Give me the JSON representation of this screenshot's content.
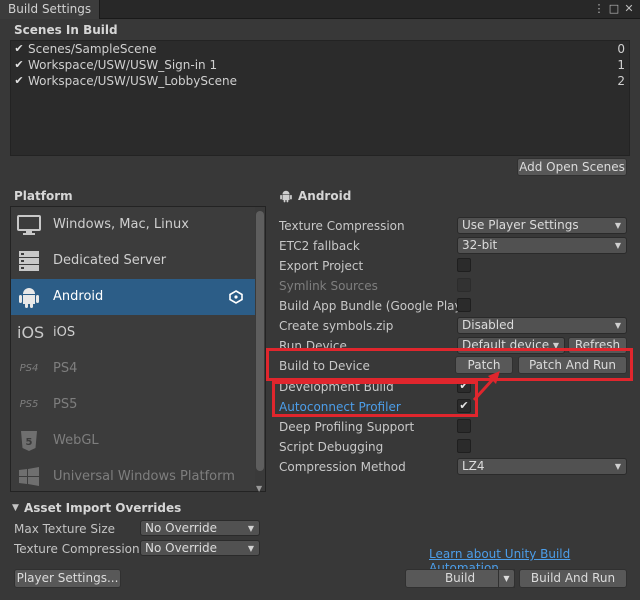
{
  "window": {
    "tab_title": "Build Settings"
  },
  "scenes": {
    "title": "Scenes In Build",
    "items": [
      {
        "name": "Scenes/SampleScene",
        "index": "0",
        "checked": true
      },
      {
        "name": "Workspace/USW/USW_Sign-in 1",
        "index": "1",
        "checked": true
      },
      {
        "name": "Workspace/USW/USW_LobbyScene",
        "index": "2",
        "checked": true
      }
    ],
    "add_open_scenes": "Add Open Scenes"
  },
  "platform": {
    "title": "Platform",
    "items": [
      {
        "label": "Windows, Mac, Linux",
        "icon": "monitor-icon"
      },
      {
        "label": "Dedicated Server",
        "icon": "server-icon"
      },
      {
        "label": "Android",
        "icon": "android-icon",
        "selected": true
      },
      {
        "label": "iOS",
        "icon": "ios-icon",
        "glyph": "iOS"
      },
      {
        "label": "PS4",
        "icon": "ps4-icon",
        "glyph": "PS4"
      },
      {
        "label": "PS5",
        "icon": "ps5-icon",
        "glyph": "PS5"
      },
      {
        "label": "WebGL",
        "icon": "html5-icon",
        "glyph": "5"
      },
      {
        "label": "Universal Windows Platform",
        "icon": "windows-icon"
      }
    ]
  },
  "settings": {
    "platform_name": "Android",
    "texture_compression": {
      "label": "Texture Compression",
      "value": "Use Player Settings"
    },
    "etc2_fallback": {
      "label": "ETC2 fallback",
      "value": "32-bit"
    },
    "export_project": {
      "label": "Export Project"
    },
    "symlink_sources": {
      "label": "Symlink Sources"
    },
    "build_app_bundle": {
      "label": "Build App Bundle (Google Play)"
    },
    "create_symbols": {
      "label": "Create symbols.zip",
      "value": "Disabled"
    },
    "run_device": {
      "label": "Run Device",
      "value": "Default device",
      "refresh": "Refresh"
    },
    "build_to_device": {
      "label": "Build to Device",
      "patch": "Patch",
      "patch_and_run": "Patch And Run"
    },
    "development_build": {
      "label": "Development Build",
      "checked": true
    },
    "autoconnect_profiler": {
      "label": "Autoconnect Profiler",
      "checked": true
    },
    "deep_profiling": {
      "label": "Deep Profiling Support"
    },
    "script_debugging": {
      "label": "Script Debugging"
    },
    "compression_method": {
      "label": "Compression Method",
      "value": "LZ4"
    }
  },
  "asset_import": {
    "title": "Asset Import Overrides",
    "max_texture_size": {
      "label": "Max Texture Size",
      "value": "No Override"
    },
    "texture_compression": {
      "label": "Texture Compression",
      "value": "No Override"
    }
  },
  "footer": {
    "player_settings": "Player Settings...",
    "learn_link": "Learn about Unity Build Automation",
    "build": "Build",
    "build_and_run": "Build And Run"
  },
  "colors": {
    "selection": "#2c5d87",
    "highlight": "#e0262d",
    "link": "#4c9eea"
  }
}
